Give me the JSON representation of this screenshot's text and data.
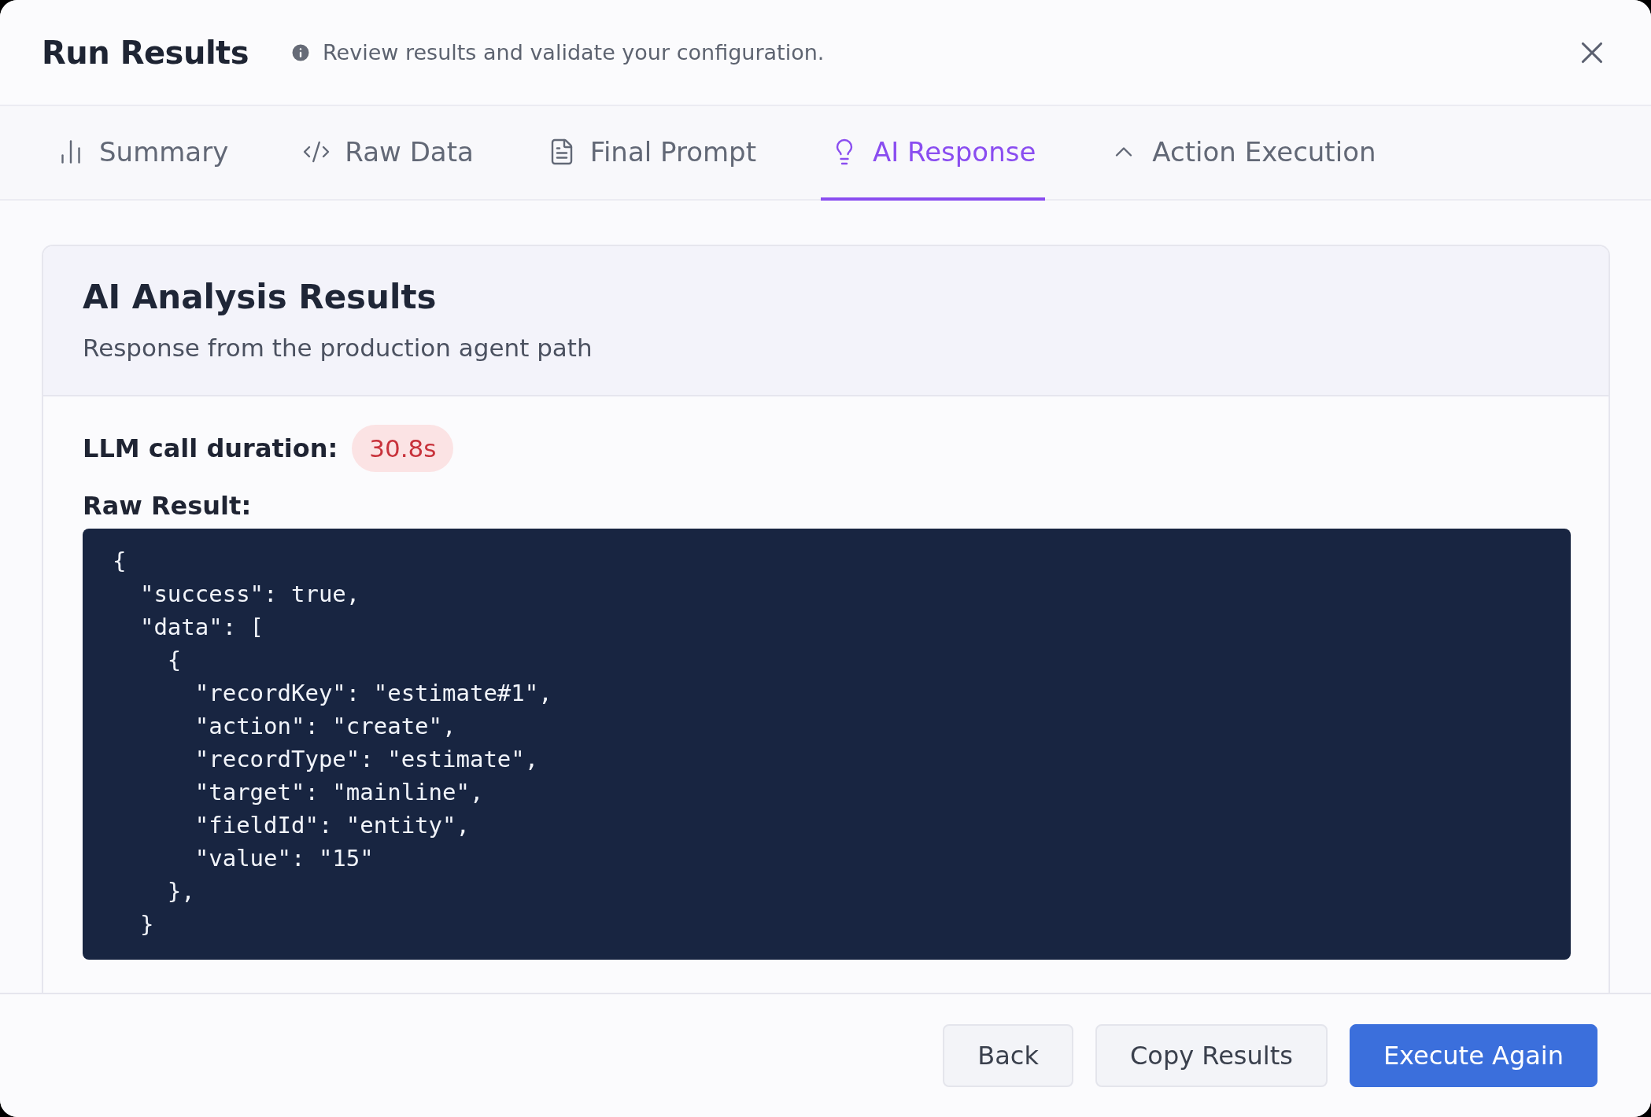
{
  "dialog": {
    "title": "Run Results",
    "subtitle": "Review results and validate your configuration."
  },
  "tabs": [
    {
      "label": "Summary",
      "kind": "chart",
      "selected": false
    },
    {
      "label": "Raw Data",
      "kind": "code",
      "selected": false
    },
    {
      "label": "Final Prompt",
      "kind": "file",
      "selected": false
    },
    {
      "label": "AI Response",
      "kind": "bulb",
      "selected": true
    },
    {
      "label": "Action Execution",
      "kind": "caret",
      "selected": false
    }
  ],
  "card": {
    "title": "AI Analysis Results",
    "description": "Response from the production agent path",
    "duration_label": "LLM call duration:",
    "duration": "30.8s",
    "raw_label": "Raw Result:",
    "code_lines": [
      "{",
      "  \"success\": true,",
      "  \"data\": [",
      "    {",
      "      \"recordKey\": \"estimate#1\",",
      "      \"action\": \"create\",",
      "      \"recordType\": \"estimate\",",
      "      \"target\": \"mainline\",",
      "      \"fieldId\": \"entity\",",
      "      \"value\": \"15\"",
      "    },",
      "  }"
    ]
  },
  "buttons": [
    {
      "label": "Back",
      "kind": "secondary"
    },
    {
      "label": "Copy Results",
      "kind": "secondary"
    },
    {
      "label": "Execute Again",
      "kind": "primary"
    }
  ]
}
